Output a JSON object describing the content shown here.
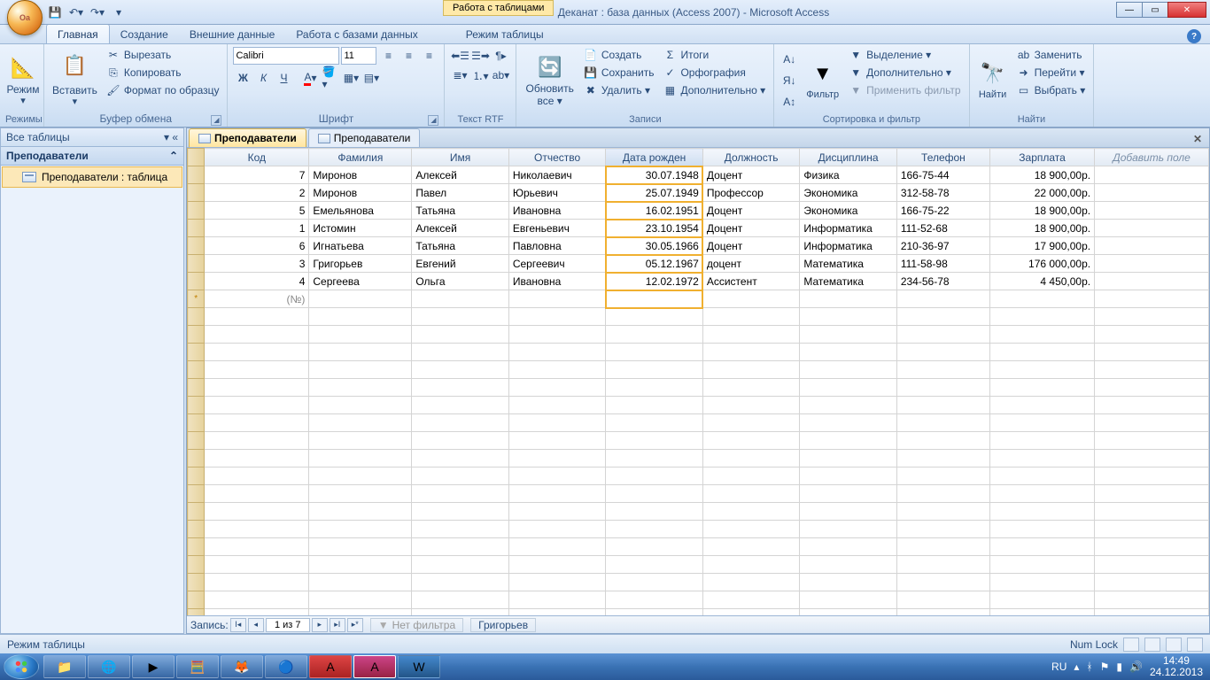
{
  "title": "Деканат : база данных (Access 2007) - Microsoft Access",
  "context_tab": "Работа с таблицами",
  "tabs": {
    "home": "Главная",
    "create": "Создание",
    "external": "Внешние данные",
    "dbtool": "Работа с базами данных",
    "datasheet": "Режим таблицы"
  },
  "ribbon": {
    "views": {
      "mode": "Режим",
      "label": "Режимы"
    },
    "clipboard": {
      "paste": "Вставить",
      "cut": "Вырезать",
      "copy": "Копировать",
      "format": "Формат по образцу",
      "label": "Буфер обмена"
    },
    "font": {
      "name": "Calibri",
      "size": "11",
      "label": "Шрифт"
    },
    "richtext": {
      "label": "Текст RTF"
    },
    "records": {
      "refresh": "Обновить",
      "refresh2": "все ▾",
      "new": "Создать",
      "save": "Сохранить",
      "delete": "Удалить ▾",
      "totals": "Итоги",
      "spell": "Орфография",
      "more": "Дополнительно ▾",
      "label": "Записи"
    },
    "sortfilter": {
      "filter": "Фильтр",
      "selection": "Выделение ▾",
      "advanced": "Дополнительно ▾",
      "toggle": "Применить фильтр",
      "label": "Сортировка и фильтр"
    },
    "find": {
      "find": "Найти",
      "replace": "Заменить",
      "goto": "Перейти ▾",
      "select": "Выбрать ▾",
      "label": "Найти"
    }
  },
  "nav": {
    "all": "Все таблицы",
    "group": "Преподаватели",
    "item": "Преподаватели : таблица"
  },
  "doc_tabs": {
    "t1": "Преподаватели",
    "t2": "Преподаватели"
  },
  "columns": {
    "kod": "Код",
    "fam": "Фамилия",
    "imya": "Имя",
    "otch": "Отчество",
    "data": "Дата рожден",
    "dolzh": "Должность",
    "disc": "Дисциплина",
    "tel": "Телефон",
    "zar": "Зарплата",
    "add": "Добавить поле"
  },
  "rows": [
    {
      "kod": "7",
      "fam": "Миронов",
      "imya": "Алексей",
      "otch": "Николаевич",
      "data": "30.07.1948",
      "dolzh": "Доцент",
      "disc": "Физика",
      "tel": "166-75-44",
      "zar": "18 900,00р."
    },
    {
      "kod": "2",
      "fam": "Миронов",
      "imya": "Павел",
      "otch": "Юрьевич",
      "data": "25.07.1949",
      "dolzh": "Профессор",
      "disc": "Экономика",
      "tel": "312-58-78",
      "zar": "22 000,00р."
    },
    {
      "kod": "5",
      "fam": "Емельянова",
      "imya": "Татьяна",
      "otch": "Ивановна",
      "data": "16.02.1951",
      "dolzh": "Доцент",
      "disc": "Экономика",
      "tel": "166-75-22",
      "zar": "18 900,00р."
    },
    {
      "kod": "1",
      "fam": "Истомин",
      "imya": "Алексей",
      "otch": "Евгеньевич",
      "data": "23.10.1954",
      "dolzh": "Доцент",
      "disc": "Информатика",
      "tel": "111-52-68",
      "zar": "18 900,00р."
    },
    {
      "kod": "6",
      "fam": "Игнатьева",
      "imya": "Татьяна",
      "otch": "Павловна",
      "data": "30.05.1966",
      "dolzh": "Доцент",
      "disc": "Информатика",
      "tel": "210-36-97",
      "zar": "17 900,00р."
    },
    {
      "kod": "3",
      "fam": "Григорьев",
      "imya": "Евгений",
      "otch": "Сергеевич",
      "data": "05.12.1967",
      "dolzh": "доцент",
      "disc": "Математика",
      "tel": "111-58-98",
      "zar": "176 000,00р."
    },
    {
      "kod": "4",
      "fam": "Сергеева",
      "imya": "Ольга",
      "otch": "Ивановна",
      "data": "12.02.1972",
      "dolzh": "Ассистент",
      "disc": "Математика",
      "tel": "234-56-78",
      "zar": "4 450,00р."
    }
  ],
  "newrow": "(№)",
  "recnav": {
    "label": "Запись:",
    "pos": "1 из 7",
    "nofilter": "Нет фильтра",
    "search": "Григорьев"
  },
  "status": {
    "mode": "Режим таблицы",
    "numlock": "Num Lock"
  },
  "tray": {
    "lang": "RU",
    "time": "14:49",
    "date": "24.12.2013"
  }
}
